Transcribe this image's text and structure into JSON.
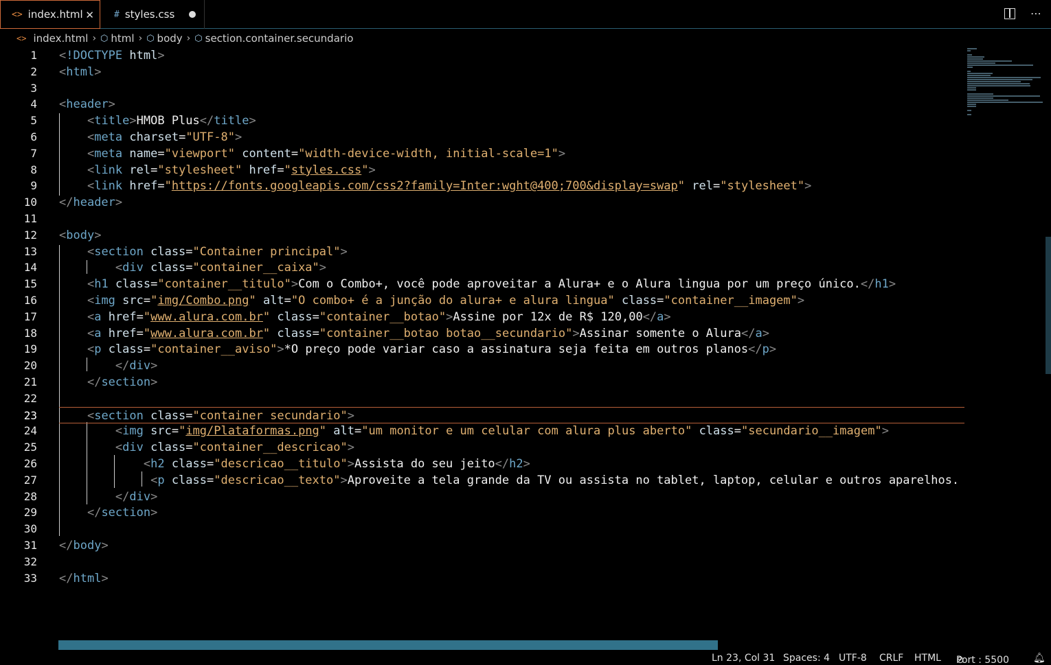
{
  "tabs": [
    {
      "icon": "<>",
      "label": "index.html"
    },
    {
      "icon": "#",
      "label": "styles.css"
    }
  ],
  "breadcrumb": [
    "index.html",
    "html",
    "body",
    "section.container.secundario"
  ],
  "lines": [
    {
      "n": "1",
      "t": [
        [
          "br",
          "<"
        ],
        [
          "tg",
          "!DOCTYPE"
        ],
        [
          "tx",
          " "
        ],
        [
          "at",
          "html"
        ],
        [
          "br",
          ">"
        ]
      ]
    },
    {
      "n": "2",
      "t": [
        [
          "br",
          "<"
        ],
        [
          "tg",
          "html"
        ],
        [
          "br",
          ">"
        ]
      ]
    },
    {
      "n": "3",
      "t": []
    },
    {
      "n": "4",
      "t": [
        [
          "br",
          "<"
        ],
        [
          "tg",
          "header"
        ],
        [
          "br",
          ">"
        ]
      ]
    },
    {
      "n": "5",
      "t": [
        [
          "tx",
          "    "
        ],
        [
          "br",
          "<"
        ],
        [
          "tg",
          "title"
        ],
        [
          "br",
          ">"
        ],
        [
          "tx",
          "HMOB Plus"
        ],
        [
          "br",
          "</"
        ],
        [
          "tg",
          "title"
        ],
        [
          "br",
          ">"
        ]
      ]
    },
    {
      "n": "6",
      "t": [
        [
          "tx",
          "    "
        ],
        [
          "br",
          "<"
        ],
        [
          "tg",
          "meta"
        ],
        [
          "tx",
          " "
        ],
        [
          "at",
          "charset"
        ],
        [
          "tx",
          "="
        ],
        [
          "st",
          "\"UTF-8\""
        ],
        [
          "br",
          ">"
        ]
      ]
    },
    {
      "n": "7",
      "t": [
        [
          "tx",
          "    "
        ],
        [
          "br",
          "<"
        ],
        [
          "tg",
          "meta"
        ],
        [
          "tx",
          " "
        ],
        [
          "at",
          "name"
        ],
        [
          "tx",
          "="
        ],
        [
          "st",
          "\"viewport\""
        ],
        [
          "tx",
          " "
        ],
        [
          "at",
          "content"
        ],
        [
          "tx",
          "="
        ],
        [
          "st",
          "\"width-device-width, initial-scale=1\""
        ],
        [
          "br",
          ">"
        ]
      ]
    },
    {
      "n": "8",
      "t": [
        [
          "tx",
          "    "
        ],
        [
          "br",
          "<"
        ],
        [
          "tg",
          "link"
        ],
        [
          "tx",
          " "
        ],
        [
          "at",
          "rel"
        ],
        [
          "tx",
          "="
        ],
        [
          "st",
          "\"stylesheet\""
        ],
        [
          "tx",
          " "
        ],
        [
          "at",
          "href"
        ],
        [
          "tx",
          "="
        ],
        [
          "st",
          "\""
        ],
        [
          "stu",
          "styles.css"
        ],
        [
          "st",
          "\""
        ],
        [
          "br",
          ">"
        ]
      ]
    },
    {
      "n": "9",
      "t": [
        [
          "tx",
          "    "
        ],
        [
          "br",
          "<"
        ],
        [
          "tg",
          "link"
        ],
        [
          "tx",
          " "
        ],
        [
          "at",
          "href"
        ],
        [
          "tx",
          "="
        ],
        [
          "st",
          "\""
        ],
        [
          "stu",
          "https://fonts.googleapis.com/css2?family=Inter:wght@400;700&display=swap"
        ],
        [
          "st",
          "\""
        ],
        [
          "tx",
          " "
        ],
        [
          "at",
          "rel"
        ],
        [
          "tx",
          "="
        ],
        [
          "st",
          "\"stylesheet\""
        ],
        [
          "br",
          ">"
        ]
      ]
    },
    {
      "n": "10",
      "t": [
        [
          "br",
          "</"
        ],
        [
          "tg",
          "header"
        ],
        [
          "br",
          ">"
        ]
      ]
    },
    {
      "n": "11",
      "t": []
    },
    {
      "n": "12",
      "t": [
        [
          "br",
          "<"
        ],
        [
          "tg",
          "body"
        ],
        [
          "br",
          ">"
        ]
      ]
    },
    {
      "n": "13",
      "t": [
        [
          "tx",
          "    "
        ],
        [
          "br",
          "<"
        ],
        [
          "tg",
          "section"
        ],
        [
          "tx",
          " "
        ],
        [
          "at",
          "class"
        ],
        [
          "tx",
          "="
        ],
        [
          "st",
          "\"Container principal\""
        ],
        [
          "br",
          ">"
        ]
      ]
    },
    {
      "n": "14",
      "t": [
        [
          "tx",
          "        "
        ],
        [
          "br",
          "<"
        ],
        [
          "tg",
          "div"
        ],
        [
          "tx",
          " "
        ],
        [
          "at",
          "class"
        ],
        [
          "tx",
          "="
        ],
        [
          "st",
          "\"container__caixa\""
        ],
        [
          "br",
          ">"
        ]
      ]
    },
    {
      "n": "15",
      "t": [
        [
          "tx",
          "    "
        ],
        [
          "br",
          "<"
        ],
        [
          "tg",
          "h1"
        ],
        [
          "tx",
          " "
        ],
        [
          "at",
          "class"
        ],
        [
          "tx",
          "="
        ],
        [
          "st",
          "\"container__titulo\""
        ],
        [
          "br",
          ">"
        ],
        [
          "tx",
          "Com o Combo+, você pode aproveitar a Alura+ e o Alura lingua por um preço único."
        ],
        [
          "br",
          "</"
        ],
        [
          "tg",
          "h1"
        ],
        [
          "br",
          ">"
        ]
      ]
    },
    {
      "n": "16",
      "t": [
        [
          "tx",
          "    "
        ],
        [
          "br",
          "<"
        ],
        [
          "tg",
          "img"
        ],
        [
          "tx",
          " "
        ],
        [
          "at",
          "src"
        ],
        [
          "tx",
          "="
        ],
        [
          "st",
          "\""
        ],
        [
          "stu",
          "img/Combo.png"
        ],
        [
          "st",
          "\""
        ],
        [
          "tx",
          " "
        ],
        [
          "at",
          "alt"
        ],
        [
          "tx",
          "="
        ],
        [
          "st",
          "\"O combo+ é a junção do alura+ e alura lingua\""
        ],
        [
          "tx",
          " "
        ],
        [
          "at",
          "class"
        ],
        [
          "tx",
          "="
        ],
        [
          "st",
          "\"container__imagem\""
        ],
        [
          "br",
          ">"
        ]
      ]
    },
    {
      "n": "17",
      "t": [
        [
          "tx",
          "    "
        ],
        [
          "br",
          "<"
        ],
        [
          "tg",
          "a"
        ],
        [
          "tx",
          " "
        ],
        [
          "at",
          "href"
        ],
        [
          "tx",
          "="
        ],
        [
          "st",
          "\""
        ],
        [
          "stu",
          "www.alura.com.br"
        ],
        [
          "st",
          "\""
        ],
        [
          "tx",
          " "
        ],
        [
          "at",
          "class"
        ],
        [
          "tx",
          "="
        ],
        [
          "st",
          "\"container__botao\""
        ],
        [
          "br",
          ">"
        ],
        [
          "tx",
          "Assine por 12x de R$ 120,00"
        ],
        [
          "br",
          "</"
        ],
        [
          "tg",
          "a"
        ],
        [
          "br",
          ">"
        ]
      ]
    },
    {
      "n": "18",
      "t": [
        [
          "tx",
          "    "
        ],
        [
          "br",
          "<"
        ],
        [
          "tg",
          "a"
        ],
        [
          "tx",
          " "
        ],
        [
          "at",
          "href"
        ],
        [
          "tx",
          "="
        ],
        [
          "st",
          "\""
        ],
        [
          "stu",
          "www.alura.com.br"
        ],
        [
          "st",
          "\""
        ],
        [
          "tx",
          " "
        ],
        [
          "at",
          "class"
        ],
        [
          "tx",
          "="
        ],
        [
          "st",
          "\"container__botao botao__secundario\""
        ],
        [
          "br",
          ">"
        ],
        [
          "tx",
          "Assinar somente o Alura"
        ],
        [
          "br",
          "</"
        ],
        [
          "tg",
          "a"
        ],
        [
          "br",
          ">"
        ]
      ]
    },
    {
      "n": "19",
      "t": [
        [
          "tx",
          "    "
        ],
        [
          "br",
          "<"
        ],
        [
          "tg",
          "p"
        ],
        [
          "tx",
          " "
        ],
        [
          "at",
          "class"
        ],
        [
          "tx",
          "="
        ],
        [
          "st",
          "\"container__aviso\""
        ],
        [
          "br",
          ">"
        ],
        [
          "tx",
          "*O preço pode variar caso a assinatura seja feita em outros planos"
        ],
        [
          "br",
          "</"
        ],
        [
          "tg",
          "p"
        ],
        [
          "br",
          ">"
        ]
      ]
    },
    {
      "n": "20",
      "t": [
        [
          "tx",
          "        "
        ],
        [
          "br",
          "</"
        ],
        [
          "tg",
          "div"
        ],
        [
          "br",
          ">"
        ]
      ]
    },
    {
      "n": "21",
      "t": [
        [
          "tx",
          "    "
        ],
        [
          "br",
          "</"
        ],
        [
          "tg",
          "section"
        ],
        [
          "br",
          ">"
        ]
      ]
    },
    {
      "n": "22",
      "t": []
    },
    {
      "n": "23",
      "t": [
        [
          "tx",
          "    "
        ],
        [
          "br",
          "<"
        ],
        [
          "tg",
          "section"
        ],
        [
          "tx",
          " "
        ],
        [
          "at",
          "class"
        ],
        [
          "tx",
          "="
        ],
        [
          "st",
          "\"container secundario\""
        ],
        [
          "br",
          ">"
        ]
      ]
    },
    {
      "n": "24",
      "t": [
        [
          "tx",
          "        "
        ],
        [
          "br",
          "<"
        ],
        [
          "tg",
          "img"
        ],
        [
          "tx",
          " "
        ],
        [
          "at",
          "src"
        ],
        [
          "tx",
          "="
        ],
        [
          "st",
          "\""
        ],
        [
          "stu",
          "img/Plataformas.png"
        ],
        [
          "st",
          "\""
        ],
        [
          "tx",
          " "
        ],
        [
          "at",
          "alt"
        ],
        [
          "tx",
          "="
        ],
        [
          "st",
          "\"um monitor e um celular com alura plus aberto\""
        ],
        [
          "tx",
          " "
        ],
        [
          "at",
          "class"
        ],
        [
          "tx",
          "="
        ],
        [
          "st",
          "\"secundario__imagem\""
        ],
        [
          "br",
          ">"
        ]
      ]
    },
    {
      "n": "25",
      "t": [
        [
          "tx",
          "        "
        ],
        [
          "br",
          "<"
        ],
        [
          "tg",
          "div"
        ],
        [
          "tx",
          " "
        ],
        [
          "at",
          "class"
        ],
        [
          "tx",
          "="
        ],
        [
          "st",
          "\"container__descricao\""
        ],
        [
          "br",
          ">"
        ]
      ]
    },
    {
      "n": "26",
      "t": [
        [
          "tx",
          "            "
        ],
        [
          "br",
          "<"
        ],
        [
          "tg",
          "h2"
        ],
        [
          "tx",
          " "
        ],
        [
          "at",
          "class"
        ],
        [
          "tx",
          "="
        ],
        [
          "st",
          "\"descricao__titulo\""
        ],
        [
          "br",
          ">"
        ],
        [
          "tx",
          "Assista do seu jeito"
        ],
        [
          "br",
          "</"
        ],
        [
          "tg",
          "h2"
        ],
        [
          "br",
          ">"
        ]
      ]
    },
    {
      "n": "27",
      "t": [
        [
          "tx",
          "             "
        ],
        [
          "br",
          "<"
        ],
        [
          "tg",
          "p"
        ],
        [
          "tx",
          " "
        ],
        [
          "at",
          "class"
        ],
        [
          "tx",
          "="
        ],
        [
          "st",
          "\"descricao__texto\""
        ],
        [
          "br",
          ">"
        ],
        [
          "tx",
          "Aproveite a tela grande da TV ou assista no tablet, laptop, celular e outros aparelhos. Nos"
        ]
      ]
    },
    {
      "n": "28",
      "t": [
        [
          "tx",
          "        "
        ],
        [
          "br",
          "</"
        ],
        [
          "tg",
          "div"
        ],
        [
          "br",
          ">"
        ]
      ]
    },
    {
      "n": "29",
      "t": [
        [
          "tx",
          "    "
        ],
        [
          "br",
          "</"
        ],
        [
          "tg",
          "section"
        ],
        [
          "br",
          ">"
        ]
      ]
    },
    {
      "n": "30",
      "t": []
    },
    {
      "n": "31",
      "t": [
        [
          "br",
          "</"
        ],
        [
          "tg",
          "body"
        ],
        [
          "br",
          ">"
        ]
      ]
    },
    {
      "n": "32",
      "t": []
    },
    {
      "n": "33",
      "t": [
        [
          "br",
          "</"
        ],
        [
          "tg",
          "html"
        ],
        [
          "br",
          ">"
        ]
      ]
    }
  ],
  "current_line": "23",
  "status": {
    "position": "Ln 23, Col 31",
    "spaces": "Spaces: 4",
    "encoding": "UTF-8",
    "eol": "CRLF",
    "language": "HTML",
    "port": "Port : 5500"
  }
}
